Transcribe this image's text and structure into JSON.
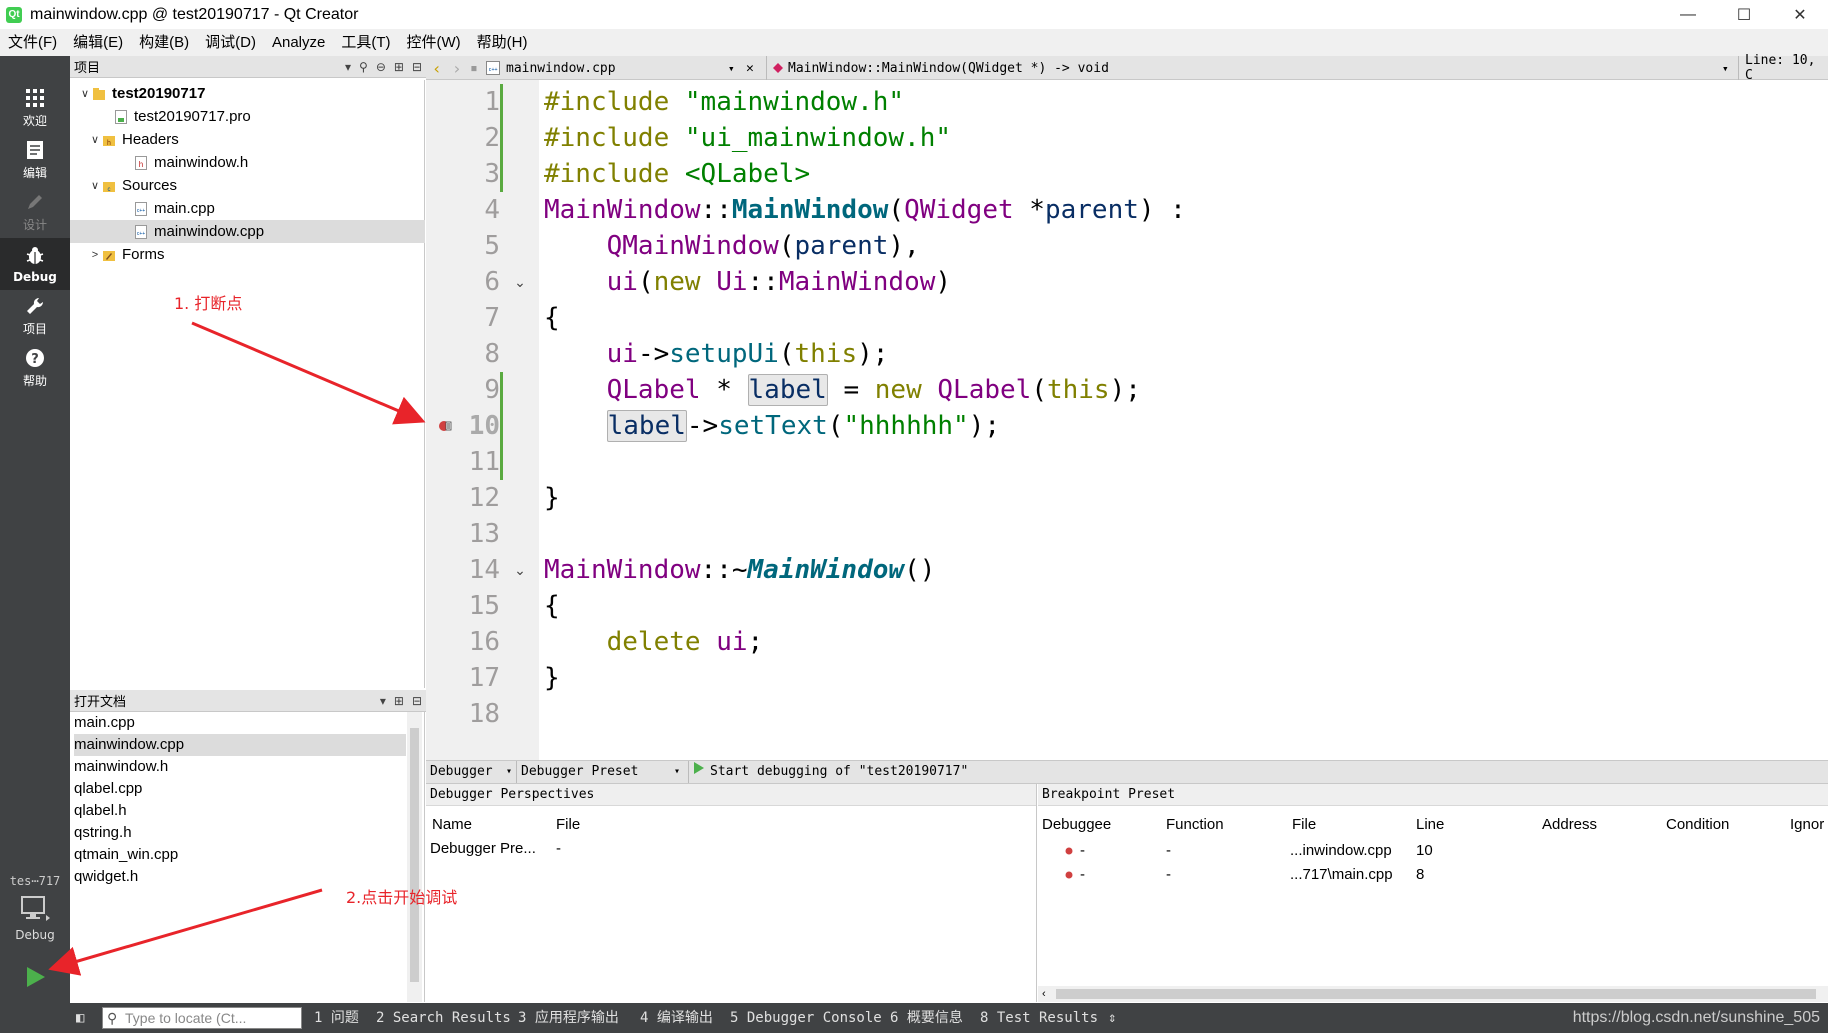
{
  "window": {
    "title": "mainwindow.cpp @ test20190717 - Qt Creator",
    "controls": [
      "—",
      "☐",
      "✕"
    ]
  },
  "menu": [
    "文件(F)",
    "编辑(E)",
    "构建(B)",
    "调试(D)",
    "Analyze",
    "工具(T)",
    "控件(W)",
    "帮助(H)"
  ],
  "modes": [
    {
      "label": "欢迎",
      "icon": "grid-icon"
    },
    {
      "label": "编辑",
      "icon": "document-icon"
    },
    {
      "label": "设计",
      "icon": "pencil-icon"
    },
    {
      "label": "Debug",
      "icon": "bug-icon"
    },
    {
      "label": "项目",
      "icon": "wrench-icon"
    },
    {
      "label": "帮助",
      "icon": "help-icon"
    }
  ],
  "kit": {
    "name": "tes⋯717",
    "label": "Debug"
  },
  "projects_pane": {
    "title": "项目",
    "tree": [
      {
        "label": "test20190717",
        "arrow": "∨",
        "level": 0,
        "bold": true
      },
      {
        "label": "test20190717.pro",
        "arrow": "",
        "level": 1
      },
      {
        "label": "Headers",
        "arrow": "∨",
        "level": 1
      },
      {
        "label": "mainwindow.h",
        "arrow": "",
        "level": 2
      },
      {
        "label": "Sources",
        "arrow": "∨",
        "level": 1
      },
      {
        "label": "main.cpp",
        "arrow": "",
        "level": 2
      },
      {
        "label": "mainwindow.cpp",
        "arrow": "",
        "level": 2,
        "selected": true
      },
      {
        "label": "Forms",
        "arrow": ">",
        "level": 1
      }
    ]
  },
  "open_docs": {
    "title": "打开文档",
    "items": [
      "main.cpp",
      "mainwindow.cpp",
      "mainwindow.h",
      "qlabel.cpp",
      "qlabel.h",
      "qstring.h",
      "qtmain_win.cpp",
      "qwidget.h"
    ],
    "selected_index": 1
  },
  "editor_toolbar": {
    "file": "mainwindow.cpp",
    "symbol": "MainWindow::MainWindow(QWidget *) -> void",
    "position": "Line: 10, C"
  },
  "editor": {
    "line_numbers": [
      "1",
      "2",
      "3",
      "4",
      "5",
      "6",
      "7",
      "8",
      "9",
      "10",
      "11",
      "12",
      "13",
      "14",
      "15",
      "16",
      "17",
      "18"
    ],
    "current_line": "10",
    "breakpoint_line": "10"
  },
  "debugger_toolbar": {
    "debugger": "Debugger",
    "preset": "Debugger Preset",
    "start": "Start debugging of \"test20190717\""
  },
  "perspectives": {
    "title": "Debugger Perspectives",
    "columns": [
      "Name",
      "File"
    ],
    "rows": [
      [
        "Debugger Pre...",
        "-"
      ]
    ]
  },
  "breakpoints": {
    "title": "Breakpoint Preset",
    "columns": [
      "Debuggee",
      "Function",
      "File",
      "Line",
      "Address",
      "Condition",
      "Ignor"
    ],
    "rows": [
      [
        "-",
        "-",
        "...inwindow.cpp",
        "10"
      ],
      [
        "-",
        "-",
        "...717\\main.cpp",
        "8"
      ]
    ]
  },
  "statusbar": {
    "locate_placeholder": "Type to locate (Ct...",
    "tabs": [
      "1 问题",
      "2 Search Results",
      "3 应用程序输出",
      "4 编译输出",
      "5 Debugger Console",
      "6 概要信息",
      "8 Test Results"
    ],
    "watermark": "https://blog.csdn.net/sunshine_505"
  },
  "annotations": {
    "step1": "1. 打断点",
    "step2": "2.点击开始调试"
  },
  "colors": {
    "annotation": "#e8242a",
    "modebar": "#404244",
    "keyword": "#808000",
    "string": "#008000",
    "type": "#800080",
    "function": "#00677c"
  }
}
